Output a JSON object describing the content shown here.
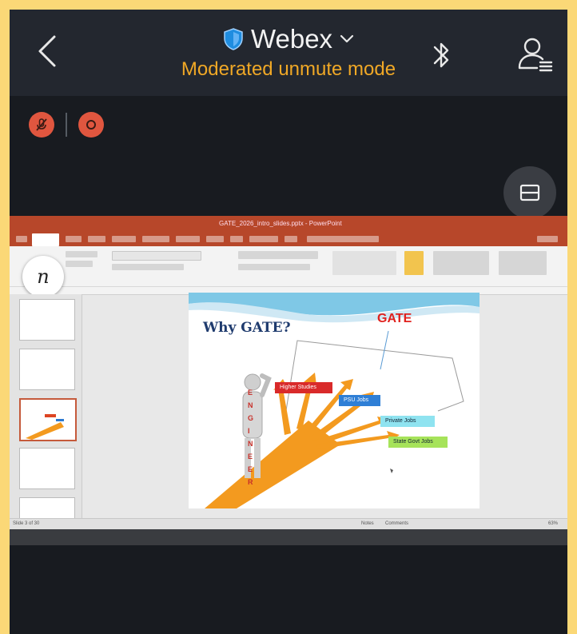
{
  "header": {
    "app_title": "Webex",
    "subtitle": "Moderated unmute mode"
  },
  "presentation": {
    "window_title": "GATE_2026_intro_slides.pptx - PowerPoint",
    "slide": {
      "title": "Why GATE?",
      "gate_label": "GATE",
      "figure_word": "ENGINEER",
      "paths": [
        "Higher Studies",
        "PSU Jobs",
        "Private Jobs",
        "State Govt Jobs"
      ]
    },
    "status": {
      "left": "Slide 3 of 30",
      "notes": "Notes",
      "comments": "Comments",
      "zoom": "63%"
    }
  },
  "colors": {
    "page_border": "#fbd877",
    "topbar": "#23272f",
    "app_bg": "#181b20",
    "subtitle": "#f0a826",
    "control_red": "#e0563f",
    "ppt_ribbon": "#b7472a",
    "gate_red": "#e0211d",
    "arrow_orange": "#f39a1f"
  },
  "icons": {
    "back": "chevron-left-icon",
    "shield": "shield-icon",
    "dropdown": "chevron-down-icon",
    "bluetooth": "bluetooth-icon",
    "participants": "participants-icon",
    "mute": "muted-mic-icon",
    "record": "record-icon",
    "layout": "layout-icon",
    "annotate": "pen-icon"
  }
}
